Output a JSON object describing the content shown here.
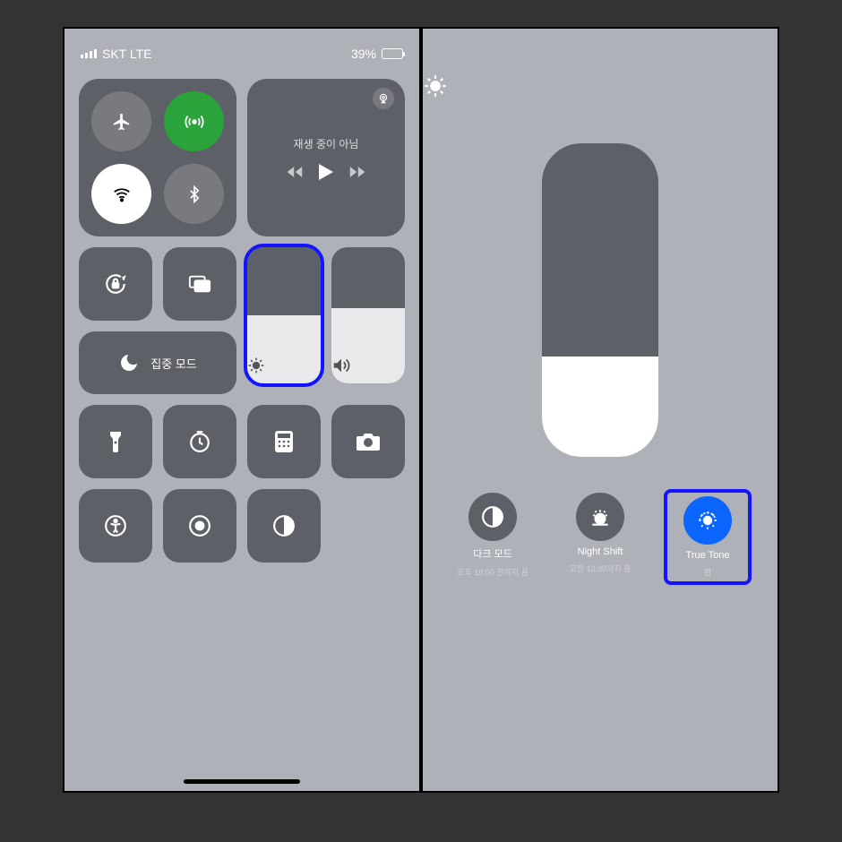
{
  "status": {
    "carrier": "SKT LTE",
    "battery_pct": "39%",
    "battery_fill": 39
  },
  "media": {
    "label": "재생 중이 아님"
  },
  "focus": {
    "label": "집중 모드"
  },
  "brightness": {
    "level_pct": 50
  },
  "volume": {
    "level_pct": 55
  },
  "detail": {
    "brightness_pct": 32,
    "dark": {
      "title": "다크 모드",
      "sub": "오후 10:00 전까지 끔"
    },
    "night": {
      "title": "Night Shift",
      "sub": "오전 12:00까지 끔"
    },
    "truetone": {
      "title": "True Tone",
      "sub": "켬"
    }
  }
}
